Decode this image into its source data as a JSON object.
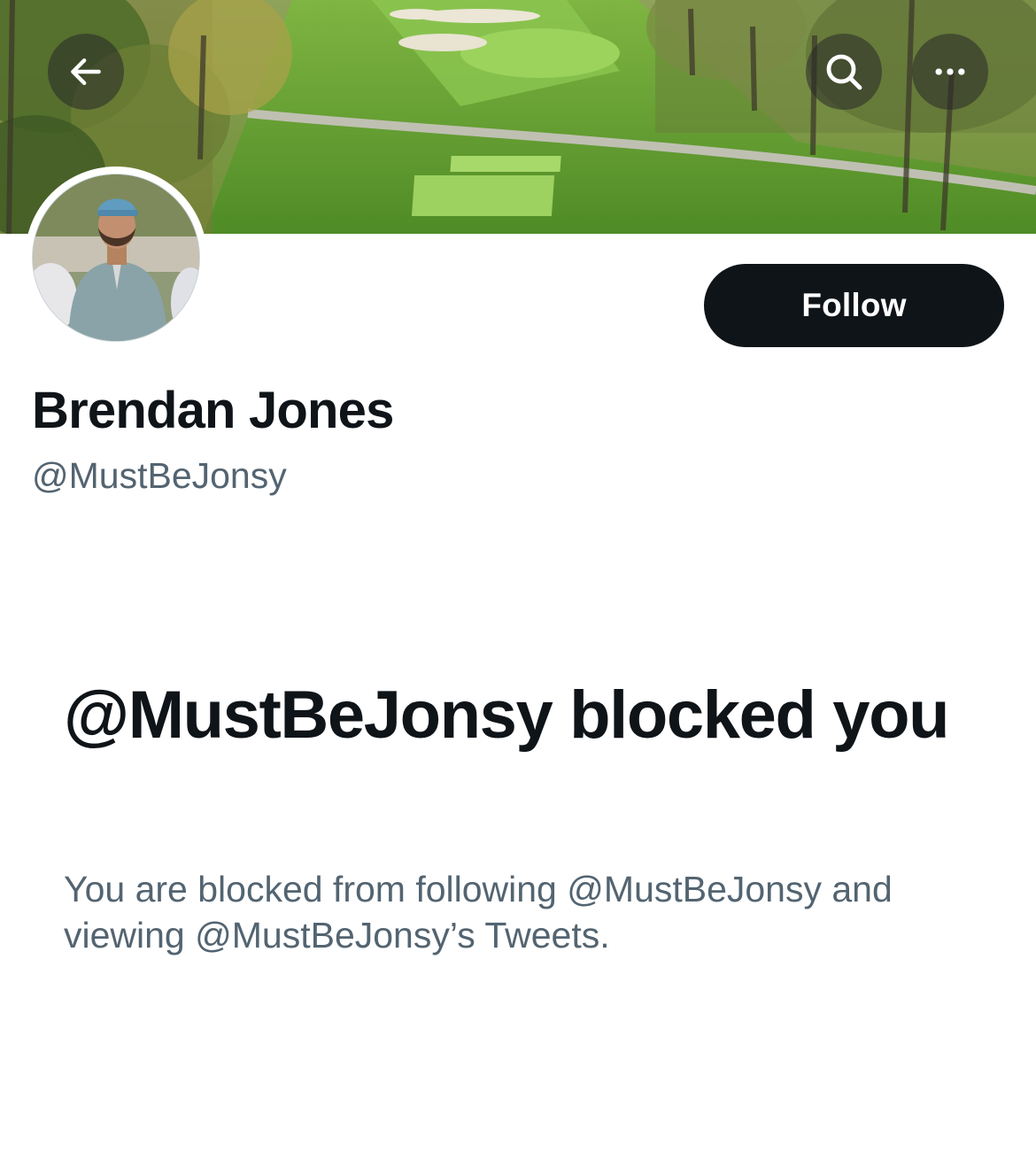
{
  "header": {
    "back_icon": "arrow-left-icon",
    "search_icon": "search-icon",
    "more_icon": "more-horizontal-icon"
  },
  "profile": {
    "display_name": "Brendan Jones",
    "handle": "@MustBeJonsy",
    "follow_label": "Follow"
  },
  "blocked": {
    "title": "@MustBeJonsy blocked you",
    "description": "You are blocked from following @MustBeJonsy and viewing @MustBeJonsy’s Tweets."
  },
  "colors": {
    "primary_text": "#0f1419",
    "secondary_text": "#536471",
    "button_bg": "#0f1419",
    "button_text": "#ffffff"
  }
}
